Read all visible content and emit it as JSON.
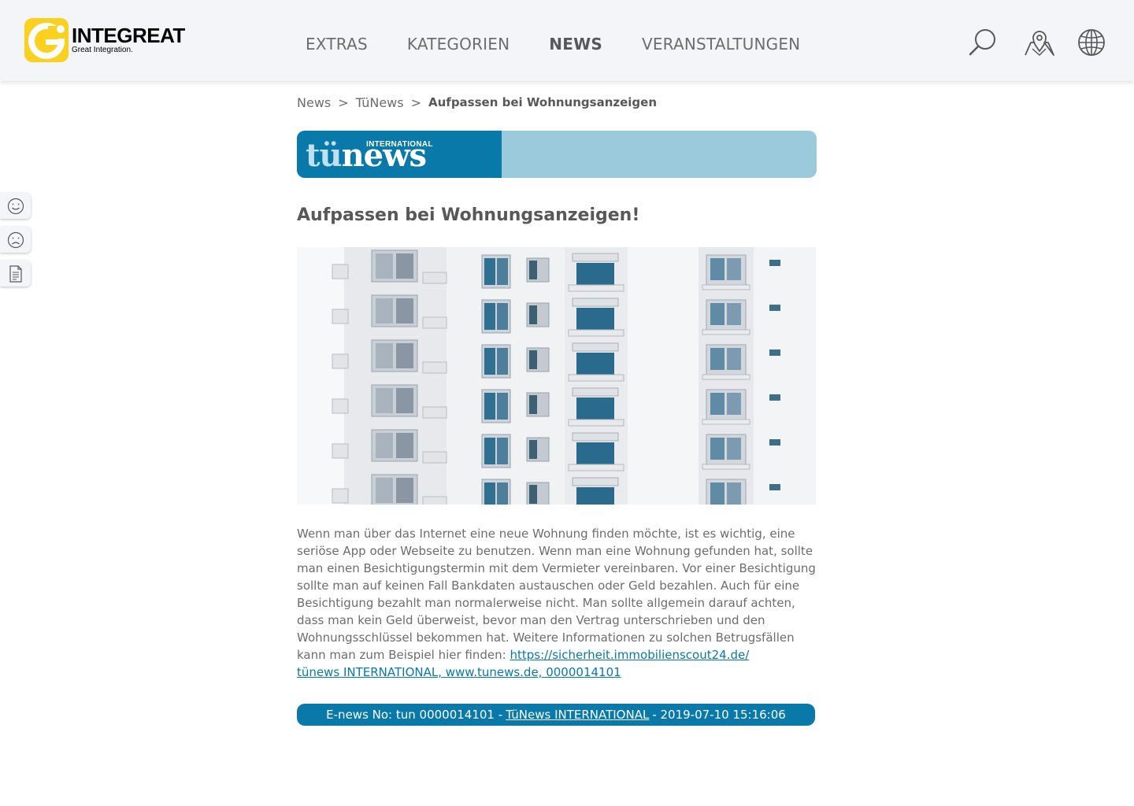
{
  "app": {
    "logo_name": "INTEGREAT",
    "logo_tagline": "Great Integration.",
    "brand_color": "#fbd01e"
  },
  "nav": {
    "items": [
      {
        "label": "EXTRAS",
        "active": false
      },
      {
        "label": "KATEGORIEN",
        "active": false
      },
      {
        "label": "NEWS",
        "active": true
      },
      {
        "label": "VERANSTALTUNGEN",
        "active": false
      }
    ]
  },
  "header_icons": [
    "search-icon",
    "location-icon",
    "globe-icon"
  ],
  "feedback": {
    "icons": [
      "smile-icon",
      "frown-icon",
      "document-icon"
    ]
  },
  "breadcrumb": {
    "items": [
      "News",
      "TüNews"
    ],
    "separator": ">",
    "current": "Aufpassen bei Wohnungsanzeigen"
  },
  "banner": {
    "intl": "INTERNATIONAL",
    "logo_prefix": "tü",
    "logo_suffix": "news",
    "left_color": "#0879a8",
    "right_color": "#9ccadd"
  },
  "article": {
    "title": "Aufpassen bei Wohnungsanzeigen!",
    "image_description_icon": "apartment-building-photo",
    "body": "Wenn man über das Internet eine neue Wohnung finden möchte, ist es wichtig, eine seriöse App oder Webseite zu benutzen. Wenn man eine Wohnung gefunden hat, sollte man einen Besichtigungstermin mit dem Vermieter vereinbaren. Vor einer Besichtigung sollte man auf keinen Fall Bankdaten austauschen oder Geld bezahlen. Auch für eine Besichtigung bezahlt man normalerweise nicht. Man sollte allgemein darauf achten, dass man kein Geld überweist, bevor man den Vertrag unterschrieben und den Wohnungsschlüssel bekommen hat. Weitere Informationen zu solchen Betrugsfällen kann man zum Beispiel hier finden: ",
    "link_text": "https://sicherheit.immobilienscout24.de/",
    "source_link": "tünews INTERNATIONAL, www.tunews.de, 0000014101"
  },
  "footer": {
    "prefix": "E-news No: tun 0000014101 -",
    "link": "TüNews INTERNATIONAL",
    "suffix": "- 2019-07-10 15:16:06"
  }
}
